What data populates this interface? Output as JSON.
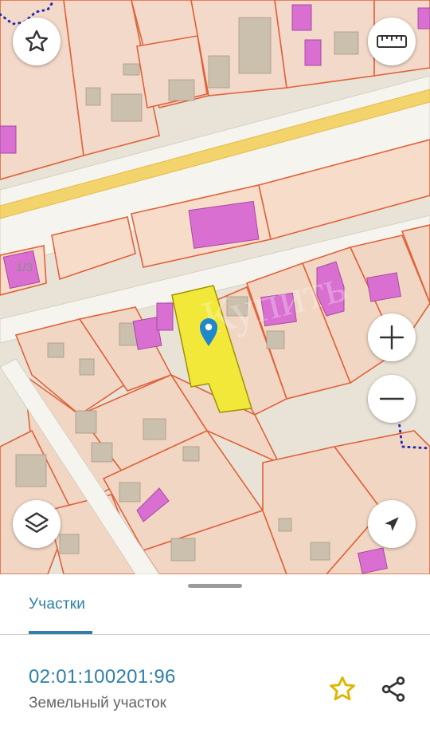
{
  "map": {
    "house_number_label": "1/3",
    "watermark_text": "Купить",
    "colors": {
      "selected_parcel_fill": "#f2e83a",
      "parcel_border": "#e0623a",
      "building": "#d86fd1",
      "road_marking": "#f3d36b",
      "pin": "#1e88c8",
      "boundary_dots": "#2a2ab0"
    }
  },
  "controls": {
    "favorite_icon": "star-outline-icon",
    "ruler_icon": "ruler-icon",
    "zoom_in_icon": "plus-icon",
    "zoom_out_icon": "minus-icon",
    "layers_icon": "layers-icon",
    "locate_icon": "navigation-arrow-icon"
  },
  "sheet": {
    "tab_label": "Участки",
    "parcel_id": "02:01:100201:96",
    "parcel_type": "Земельный участок",
    "favorite_icon": "star-icon",
    "share_icon": "share-icon",
    "accent_color": "#2f7fa8",
    "star_color": "#e0b400"
  }
}
